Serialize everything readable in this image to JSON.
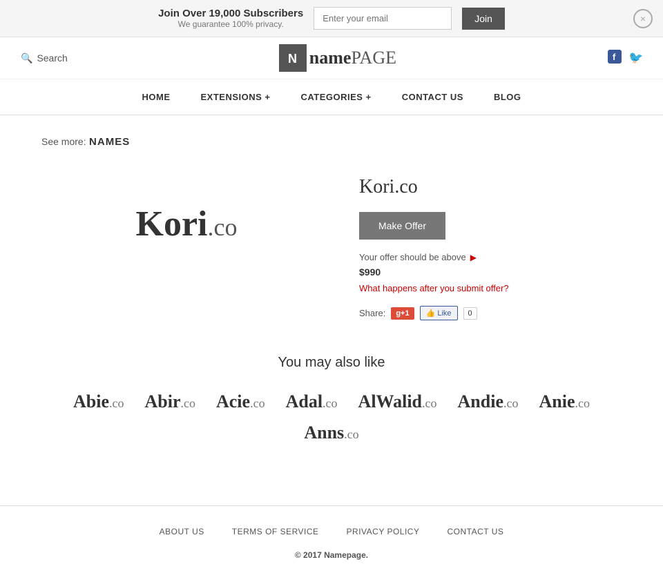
{
  "banner": {
    "title": "Join Over 19,000 Subscribers",
    "subtitle": "We guarantee 100% privacy.",
    "email_placeholder": "Enter your email",
    "join_label": "Join",
    "close_label": "×"
  },
  "header": {
    "search_label": "Search",
    "logo_icon": "N",
    "logo_name": "name",
    "logo_suffix": "PAGE"
  },
  "nav": {
    "items": [
      {
        "label": "HOME",
        "id": "home"
      },
      {
        "label": "EXTENSIONS +",
        "id": "extensions"
      },
      {
        "label": "CATEGORIES +",
        "id": "categories"
      },
      {
        "label": "CONTACT US",
        "id": "contact"
      },
      {
        "label": "BLOG",
        "id": "blog"
      }
    ]
  },
  "breadcrumb": {
    "see_more": "See more:",
    "link_label": "NAMES"
  },
  "domain": {
    "name": "Kori",
    "tld": ".co",
    "full": "Kori.co",
    "make_offer_label": "Make Offer",
    "offer_info": "Your offer should be above",
    "price": "$990",
    "what_happens": "What happens after you submit offer?",
    "share_label": "Share:",
    "gplus_label": "g+1",
    "fb_label": "👍 Like",
    "fb_count": "0"
  },
  "similar": {
    "title": "You may also like",
    "names": [
      {
        "name": "Abie",
        "tld": ".co"
      },
      {
        "name": "Abir",
        "tld": ".co"
      },
      {
        "name": "Acie",
        "tld": ".co"
      },
      {
        "name": "Adal",
        "tld": ".co"
      },
      {
        "name": "AlWalid",
        "tld": ".co"
      },
      {
        "name": "Andie",
        "tld": ".co"
      },
      {
        "name": "Anie",
        "tld": ".co"
      },
      {
        "name": "Anns",
        "tld": ".co"
      }
    ]
  },
  "footer": {
    "links": [
      {
        "label": "ABOUT US",
        "id": "about"
      },
      {
        "label": "TERMS OF SERVICE",
        "id": "terms"
      },
      {
        "label": "PRIVACY POLICY",
        "id": "privacy"
      },
      {
        "label": "CONTACT US",
        "id": "contact"
      }
    ],
    "copyright": "© 2017",
    "brand": "Namepage."
  }
}
